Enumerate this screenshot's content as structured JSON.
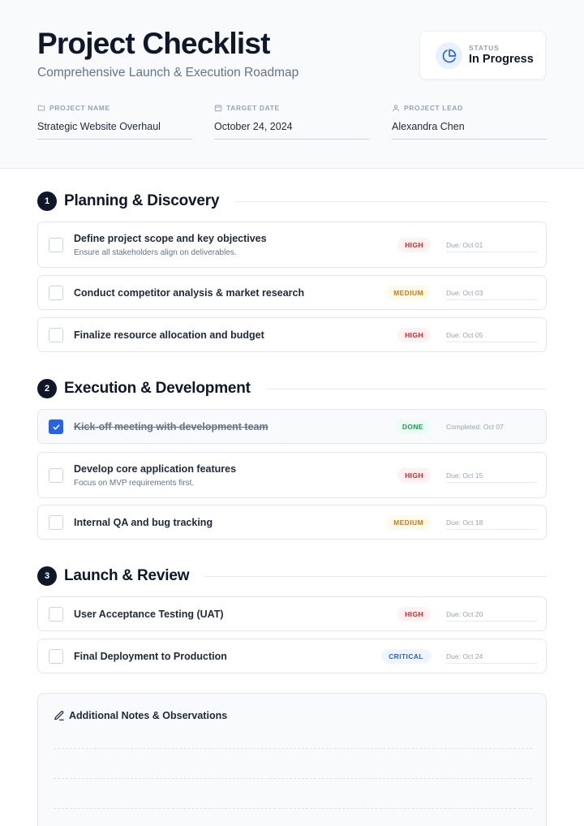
{
  "header": {
    "title": "Project Checklist",
    "subtitle": "Comprehensive Launch & Execution Roadmap",
    "status": {
      "label": "STATUS",
      "value": "In Progress",
      "icon": "pie-chart-icon",
      "accent": "#2563eb"
    },
    "meta": [
      {
        "label": "PROJECT NAME",
        "value": "Strategic Website Overhaul",
        "icon": "folder-icon"
      },
      {
        "label": "TARGET DATE",
        "value": "October 24, 2024",
        "icon": "calendar-icon"
      },
      {
        "label": "PROJECT LEAD",
        "value": "Alexandra Chen",
        "icon": "user-icon"
      }
    ]
  },
  "sections": [
    {
      "number": "1",
      "title": "Planning & Discovery",
      "tasks": [
        {
          "title": "Define project scope and key objectives",
          "note": "Ensure all stakeholders align on deliverables.",
          "priority": "HIGH",
          "due": "Due: Oct 01",
          "checked": false
        },
        {
          "title": "Conduct competitor analysis & market research",
          "priority": "MEDIUM",
          "due": "Due: Oct 03",
          "checked": false
        },
        {
          "title": "Finalize resource allocation and budget",
          "priority": "HIGH",
          "due": "Due: Oct 05",
          "checked": false
        }
      ]
    },
    {
      "number": "2",
      "title": "Execution & Development",
      "tasks": [
        {
          "title": "Kick-off meeting with development team",
          "priority": "DONE",
          "due": "Completed: Oct 07",
          "checked": true
        },
        {
          "title": "Develop core application features",
          "note": "Focus on MVP requirements first.",
          "priority": "HIGH",
          "due": "Due: Oct 15",
          "checked": false
        },
        {
          "title": "Internal QA and bug tracking",
          "priority": "MEDIUM",
          "due": "Due: Oct 18",
          "checked": false
        }
      ]
    },
    {
      "number": "3",
      "title": "Launch & Review",
      "tasks": [
        {
          "title": "User Acceptance Testing (UAT)",
          "priority": "HIGH",
          "due": "Due: Oct 20",
          "checked": false
        },
        {
          "title": "Final Deployment to Production",
          "priority": "CRITICAL",
          "due": "Due: Oct 24",
          "checked": false
        }
      ]
    }
  ],
  "notes": {
    "title": "Additional Notes & Observations",
    "icon": "pencil-icon"
  },
  "colors": {
    "high": "#dc2626",
    "medium": "#d97706",
    "done": "#16a34a",
    "critical": "#2563eb"
  }
}
